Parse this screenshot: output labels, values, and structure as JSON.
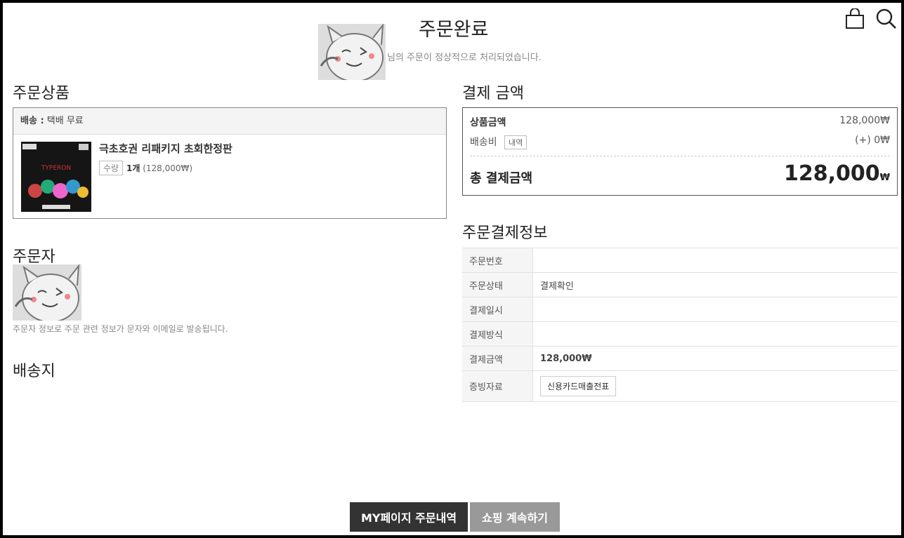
{
  "header": {
    "title": "주문완료",
    "subtitle": "님의 주문이 정상적으로 처리되었습니다."
  },
  "icons": {
    "cart": "shopping-bag-icon",
    "search": "search-icon"
  },
  "order_items": {
    "heading": "주문상품",
    "shipping_label": "배송 :",
    "shipping_value": "택배 무료",
    "product_name": "극초호권 리패키지 초회한정판",
    "qty_label": "수량",
    "qty_value": "1개",
    "qty_price": "(128,000₩)"
  },
  "orderer": {
    "heading": "주문자",
    "note": "주문자 정보로 주문 관련 정보가 문자와 이메일로 발송됩니다."
  },
  "shipping_address": {
    "heading": "배송지"
  },
  "payment_amount": {
    "heading": "결제 금액",
    "product_amount_label": "상품금액",
    "product_amount_value": "128,000₩",
    "shipping_fee_label": "배송비",
    "shipping_detail_label": "내역",
    "shipping_fee_value": "(+) 0₩",
    "total_label": "총 결제금액",
    "total_value": "128,000",
    "total_currency": "₩"
  },
  "payment_info": {
    "heading": "주문결제정보",
    "rows": [
      {
        "key": "주문번호",
        "value": ""
      },
      {
        "key": "주문상태",
        "value": "결제확인"
      },
      {
        "key": "결제일시",
        "value": ""
      },
      {
        "key": "결제방식",
        "value": ""
      },
      {
        "key": "결제금액",
        "value": "128,000₩"
      },
      {
        "key": "증빙자료",
        "value": ""
      }
    ],
    "receipt_button": "신용카드매출전표"
  },
  "buttons": {
    "my_orders": "MY페이지 주문내역",
    "continue_shopping": "쇼핑 계속하기"
  }
}
